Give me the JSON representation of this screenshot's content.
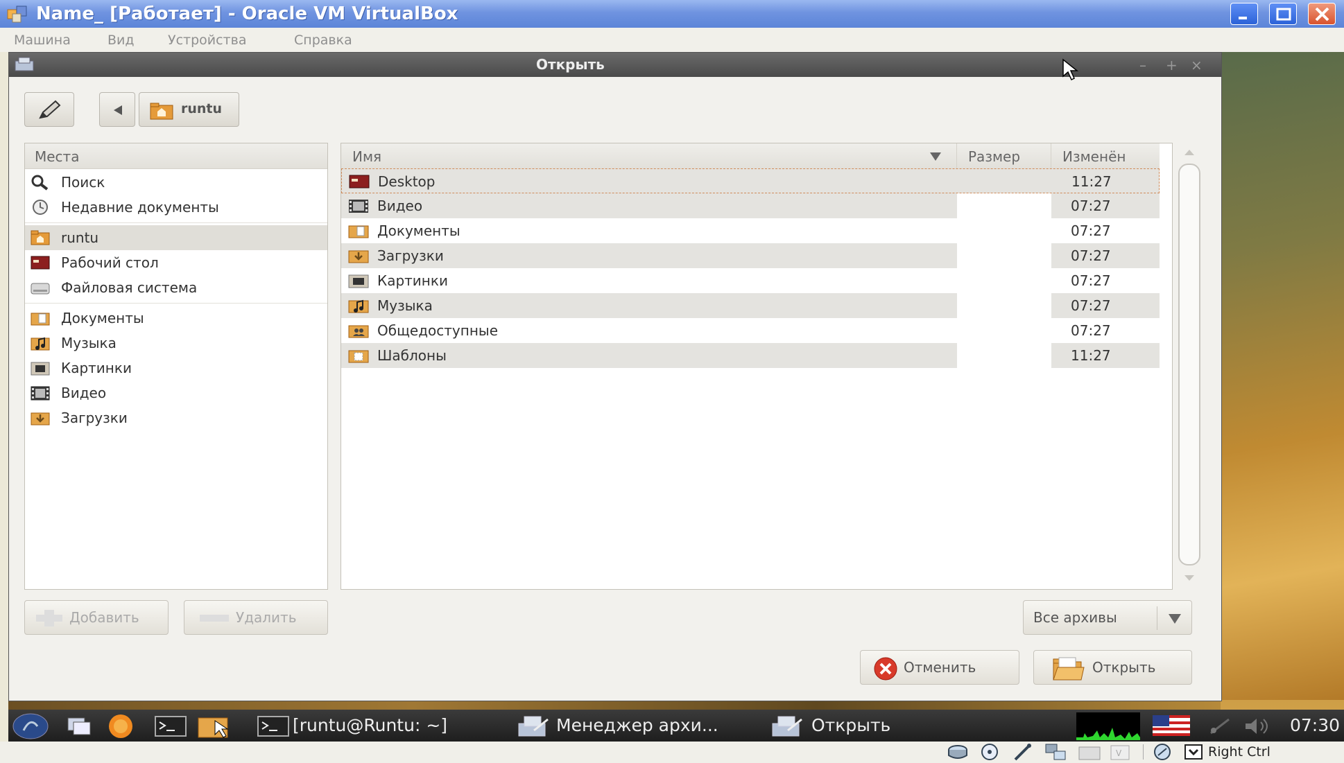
{
  "host": {
    "title": "Name_ [Работает] - Oracle VM VirtualBox",
    "menu": [
      "Машина",
      "Вид",
      "Устройства",
      "Справка"
    ],
    "hostkey_label": "Right Ctrl"
  },
  "dialog": {
    "title": "Открыть",
    "path_button": "runtu",
    "places_header": "Места",
    "places": [
      {
        "label": "Поиск",
        "icon": "search-icon"
      },
      {
        "label": "Недавние документы",
        "icon": "recent-icon"
      },
      {
        "label": "runtu",
        "icon": "home-folder-icon"
      },
      {
        "label": "Рабочий стол",
        "icon": "desktop-icon"
      },
      {
        "label": "Файловая система",
        "icon": "drive-icon"
      },
      {
        "label": "Документы",
        "icon": "documents-folder-icon"
      },
      {
        "label": "Музыка",
        "icon": "music-folder-icon"
      },
      {
        "label": "Картинки",
        "icon": "pictures-folder-icon"
      },
      {
        "label": "Видео",
        "icon": "video-folder-icon"
      },
      {
        "label": "Загрузки",
        "icon": "downloads-folder-icon"
      }
    ],
    "columns": {
      "name": "Имя",
      "size": "Размер",
      "modified": "Изменён"
    },
    "files": [
      {
        "name": "Desktop",
        "modified": "11:27",
        "icon": "desktop-icon"
      },
      {
        "name": "Видео",
        "modified": "07:27",
        "icon": "video-folder-icon"
      },
      {
        "name": "Документы",
        "modified": "07:27",
        "icon": "documents-folder-icon"
      },
      {
        "name": "Загрузки",
        "modified": "07:27",
        "icon": "downloads-folder-icon"
      },
      {
        "name": "Картинки",
        "modified": "07:27",
        "icon": "pictures-folder-icon"
      },
      {
        "name": "Музыка",
        "modified": "07:27",
        "icon": "music-folder-icon"
      },
      {
        "name": "Общедоступные",
        "modified": "07:27",
        "icon": "public-folder-icon"
      },
      {
        "name": "Шаблоны",
        "modified": "11:27",
        "icon": "templates-folder-icon"
      }
    ],
    "add_button": "Добавить",
    "remove_button": "Удалить",
    "filter": "Все архивы",
    "cancel_button": "Отменить",
    "open_button": "Открыть"
  },
  "taskbar": {
    "tasks": [
      "[runtu@Runtu: ~]",
      "Менеджер архи...",
      "Открыть"
    ],
    "clock": "07:30"
  },
  "colors": {
    "selection_border": "#d08b5a",
    "titlebar": "#5c85d8",
    "close_red": "#d8532e"
  }
}
